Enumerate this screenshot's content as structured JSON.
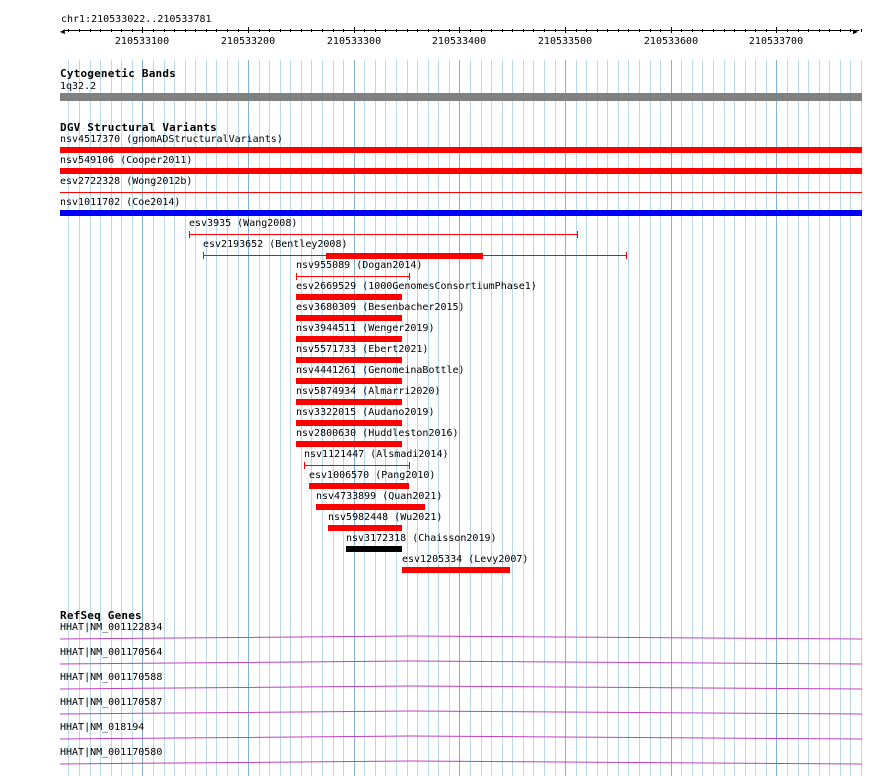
{
  "browser": {
    "location": "chr1:210533022..210533781",
    "ruler_ticks": [
      "210533100",
      "210533200",
      "210533300",
      "210533400",
      "210533500",
      "210533600",
      "210533700"
    ],
    "colors": {
      "grid": "#b8d8ec",
      "loss": "#ff0000",
      "gain": "#0000ff",
      "complex": "#000000",
      "gene": "#c040c0"
    }
  },
  "cytoband": {
    "title": "Cytogenetic Bands",
    "band": "1q32.2",
    "color": "#808080"
  },
  "dgv": {
    "title": "DGV Structural Variants",
    "features": [
      {
        "label": "nsv4517370 (gnomADStructuralVariants)",
        "start": 210533022,
        "end": 210533781,
        "style": "thick",
        "color": "#ff0000"
      },
      {
        "label": "nsv549106 (Cooper2011)",
        "start": 210533022,
        "end": 210533781,
        "style": "thick",
        "color": "#ff0000"
      },
      {
        "label": "esv2722328 (Wong2012b)",
        "start": 210533022,
        "end": 210533781,
        "style": "line",
        "color": "#ff0000"
      },
      {
        "label": "nsv1011702 (Coe2014)",
        "start": 210533022,
        "end": 210533781,
        "style": "thick",
        "color": "#0000ff"
      },
      {
        "label": "esv3935 (Wang2008)",
        "start": 210533144,
        "end": 210533511,
        "style": "capped",
        "color": "#ff0000"
      },
      {
        "label": "esv2193652 (Bentley2008)",
        "start": 210533157,
        "end": 210533558,
        "style": "capped",
        "color": "#ff0000",
        "thick_start": 210533274,
        "thick_end": 210533422
      },
      {
        "label": "nsv955089 (Dogan2014)",
        "start": 210533245,
        "end": 210533352,
        "style": "capped",
        "color": "#ff0000"
      },
      {
        "label": "esv2669529 (1000GenomesConsortiumPhase1)",
        "start": 210533245,
        "end": 210533346,
        "style": "thick",
        "color": "#ff0000"
      },
      {
        "label": "esv3680309 (Besenbacher2015)",
        "start": 210533245,
        "end": 210533346,
        "style": "thick",
        "color": "#ff0000"
      },
      {
        "label": "nsv3944511 (Wenger2019)",
        "start": 210533245,
        "end": 210533346,
        "style": "thick",
        "color": "#ff0000"
      },
      {
        "label": "nsv5571733 (Ebert2021)",
        "start": 210533245,
        "end": 210533346,
        "style": "thick",
        "color": "#ff0000"
      },
      {
        "label": "nsv4441261 (GenomeinaBottle)",
        "start": 210533245,
        "end": 210533346,
        "style": "thick",
        "color": "#ff0000"
      },
      {
        "label": "nsv5874934 (Almarri2020)",
        "start": 210533245,
        "end": 210533346,
        "style": "thick",
        "color": "#ff0000"
      },
      {
        "label": "nsv3322015 (Audano2019)",
        "start": 210533245,
        "end": 210533346,
        "style": "thick",
        "color": "#ff0000"
      },
      {
        "label": "nsv2800630 (Huddleston2016)",
        "start": 210533245,
        "end": 210533346,
        "style": "thick",
        "color": "#ff0000"
      },
      {
        "label": "nsv1121447 (Alsmadi2014)",
        "start": 210533253,
        "end": 210533352,
        "style": "capped",
        "color": "#ff0000"
      },
      {
        "label": "esv1006570 (Pang2010)",
        "start": 210533258,
        "end": 210533352,
        "style": "thick",
        "color": "#ff0000"
      },
      {
        "label": "nsv4733899 (Quan2021)",
        "start": 210533264,
        "end": 210533367,
        "style": "thick",
        "color": "#ff0000"
      },
      {
        "label": "nsv5982448 (Wu2021)",
        "start": 210533276,
        "end": 210533346,
        "style": "thick",
        "color": "#ff0000"
      },
      {
        "label": "nsv3172318 (Chaisson2019)",
        "start": 210533293,
        "end": 210533346,
        "style": "thick",
        "color": "#000000"
      },
      {
        "label": "esv1205334 (Levy2007)",
        "start": 210533346,
        "end": 210533448,
        "style": "thick",
        "color": "#ff0000"
      }
    ]
  },
  "refseq": {
    "title": "RefSeq Genes",
    "genes": [
      {
        "label": "HHAT|NM_001122834"
      },
      {
        "label": "HHAT|NM_001170564"
      },
      {
        "label": "HHAT|NM_001170588"
      },
      {
        "label": "HHAT|NM_001170587"
      },
      {
        "label": "HHAT|NM_018194"
      },
      {
        "label": "HHAT|NM_001170580"
      }
    ]
  }
}
